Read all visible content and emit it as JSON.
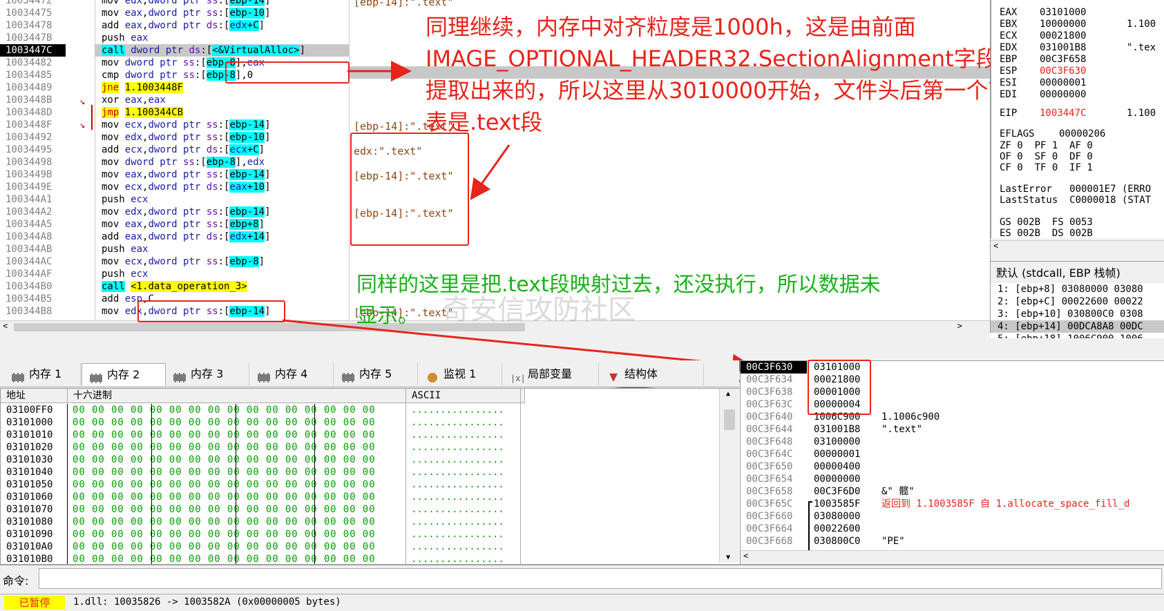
{
  "disasm": {
    "addresses": [
      "10034472",
      "10034475",
      "10034478",
      "1003447B",
      "1003447C",
      "10034482",
      "10034485",
      "10034489",
      "1003448B",
      "1003448D",
      "1003448F",
      "10034492",
      "10034495",
      "10034498",
      "1003449B",
      "1003449E",
      "100344A1",
      "100344A2",
      "100344A5",
      "100344A8",
      "100344AB",
      "100344AC",
      "100344AF",
      "100344B0",
      "100344B5",
      "100344B8"
    ],
    "top_partial_address": "10034471",
    "top_partial_instr": "push ecx",
    "instructions": [
      {
        "m": "mov",
        "ops": "edx,dword ptr ss:[ebp-14]"
      },
      {
        "m": "mov",
        "ops": "eax,dword ptr ss:[ebp-10]"
      },
      {
        "m": "add",
        "ops": "eax,dword ptr ds:[edx+C]"
      },
      {
        "m": "push",
        "ops": "eax"
      },
      {
        "m": "call",
        "ops": "dword ptr ds:[<&VirtualAlloc>]"
      },
      {
        "m": "mov",
        "ops": "dword ptr ss:[ebp-8],eax"
      },
      {
        "m": "cmp",
        "ops": "dword ptr ss:[ebp-8],0"
      },
      {
        "m": "jne",
        "ops": "1.1003448F"
      },
      {
        "m": "xor",
        "ops": "eax,eax"
      },
      {
        "m": "jmp",
        "ops": "1.100344CB"
      },
      {
        "m": "mov",
        "ops": "ecx,dword ptr ss:[ebp-14]"
      },
      {
        "m": "mov",
        "ops": "edx,dword ptr ss:[ebp-10]"
      },
      {
        "m": "add",
        "ops": "ecx,dword ptr ds:[ecx+C]"
      },
      {
        "m": "mov",
        "ops": "dword ptr ss:[ebp-8],edx"
      },
      {
        "m": "mov",
        "ops": "eax,dword ptr ss:[ebp-14]"
      },
      {
        "m": "mov",
        "ops": "ecx,dword ptr ds:[eax+10]"
      },
      {
        "m": "push",
        "ops": "ecx"
      },
      {
        "m": "mov",
        "ops": "edx,dword ptr ss:[ebp-14]"
      },
      {
        "m": "mov",
        "ops": "eax,dword ptr ss:[ebp+8]"
      },
      {
        "m": "add",
        "ops": "eax,dword ptr ds:[edx+14]"
      },
      {
        "m": "push",
        "ops": "eax"
      },
      {
        "m": "mov",
        "ops": "ecx,dword ptr ss:[ebp-8]"
      },
      {
        "m": "push",
        "ops": "ecx"
      },
      {
        "m": "call",
        "ops": "<1.data_operation_3>"
      },
      {
        "m": "add",
        "ops": "esp,C"
      },
      {
        "m": "mov",
        "ops": "edx,dword ptr ss:[ebp-14]"
      }
    ],
    "comments": [
      {
        "row": 0,
        "text": "[ebp-14]:\".text\""
      },
      {
        "row": 10,
        "text": "[ebp-14]:\".text\""
      },
      {
        "row": 12,
        "text": "edx:\".text\""
      },
      {
        "row": 14,
        "text": "[ebp-14]:\".text\""
      },
      {
        "row": 17,
        "text": "[ebp-14]:\".text\""
      },
      {
        "row": 25,
        "text": "[ebp-14]:\".text\""
      }
    ]
  },
  "annotations": {
    "red_note_lines": [
      "同理继续，内存中对齐粒度是1000h，这是由前面",
      "IMAGE_OPTIONAL_HEADER32.SectionAlignment字段",
      "提取出来的，所以这里从3010000开始，文件头后第一个节",
      "表是.text段"
    ],
    "green_note_lines": [
      "同样的这里是把.text段映射过去，还没执行，所以数据未",
      "显示。"
    ],
    "watermark": "奇安信攻防社区"
  },
  "registers": {
    "rows": [
      {
        "name": "EAX",
        "value": "03101000",
        "extra": ""
      },
      {
        "name": "EBX",
        "value": "10000000",
        "extra": "1.100"
      },
      {
        "name": "ECX",
        "value": "00021800",
        "extra": ""
      },
      {
        "name": "EDX",
        "value": "031001B8",
        "extra": "\".tex"
      },
      {
        "name": "EBP",
        "value": "00C3F658",
        "extra": ""
      },
      {
        "name": "ESP",
        "value": "00C3F630",
        "extra": ""
      },
      {
        "name": "ESI",
        "value": "00000001",
        "extra": ""
      },
      {
        "name": "EDI",
        "value": "00000000",
        "extra": ""
      }
    ],
    "eip": {
      "name": "EIP",
      "value": "1003447C",
      "extra": "1.100"
    },
    "eflags": {
      "name": "EFLAGS",
      "value": "00000206"
    },
    "flags": [
      "ZF 0  PF 1  AF 0",
      "OF 0  SF 0  DF 0",
      "CF 0  TF 0  IF 1"
    ],
    "last_error": "LastError   000001E7 (ERRO",
    "last_status": "LastStatus  C0000018 (STAT",
    "segs": [
      "GS 002B  FS 0053",
      "ES 002B  DS 002B"
    ]
  },
  "call_convention": "默认 (stdcall, EBP 栈帧)",
  "stack_args": [
    "1: [ebp+8] 03080000 03080",
    "2: [ebp+C] 00022600 00022",
    "3: [ebp+10] 030800C0 0308",
    "4: [ebp+14] 00DCA8A8 00DC",
    "5: [ebp+18] 1006C900 1006"
  ],
  "tabs": [
    {
      "label": "内存 1"
    },
    {
      "label": "内存 2"
    },
    {
      "label": "内存 3"
    },
    {
      "label": "内存 4"
    },
    {
      "label": "内存 5"
    },
    {
      "label": "监视 1"
    },
    {
      "label": "局部变量"
    },
    {
      "label": "结构体"
    }
  ],
  "dump": {
    "headers": [
      "地址",
      "十六进制",
      "ASCII"
    ],
    "rows": [
      "03100FF0",
      "03101000",
      "03101010",
      "03101020",
      "03101030",
      "03101040",
      "03101050",
      "03101060",
      "03101070",
      "03101080",
      "03101090",
      "031010A0",
      "031010B0"
    ],
    "hex_line": "00 00 00 00 00 00 00 00 00 00 00 00 00 00 00 00",
    "ascii_line": "................"
  },
  "stack": {
    "rows": [
      {
        "addr": "00C3F630",
        "val": "03101000",
        "cmt": ""
      },
      {
        "addr": "00C3F634",
        "val": "00021800",
        "cmt": ""
      },
      {
        "addr": "00C3F638",
        "val": "00001000",
        "cmt": ""
      },
      {
        "addr": "00C3F63C",
        "val": "00000004",
        "cmt": ""
      },
      {
        "addr": "00C3F640",
        "val": "1006C900",
        "cmt": "1.1006c900"
      },
      {
        "addr": "00C3F644",
        "val": "031001B8",
        "cmt": "\".text\""
      },
      {
        "addr": "00C3F648",
        "val": "03100000",
        "cmt": ""
      },
      {
        "addr": "00C3F64C",
        "val": "00000001",
        "cmt": ""
      },
      {
        "addr": "00C3F650",
        "val": "00000400",
        "cmt": ""
      },
      {
        "addr": "00C3F654",
        "val": "00000000",
        "cmt": ""
      },
      {
        "addr": "00C3F658",
        "val": "00C3F6D0",
        "cmt": "&\" 髋\""
      },
      {
        "addr": "00C3F65C",
        "val": "1003585F",
        "cmt": "返回到 1.1003585F 自 1.allocate_space_fill_d"
      },
      {
        "addr": "00C3F660",
        "val": "03080000",
        "cmt": ""
      },
      {
        "addr": "00C3F664",
        "val": "00022600",
        "cmt": ""
      },
      {
        "addr": "00C3F668",
        "val": "030800C0",
        "cmt": "\"PE\""
      }
    ]
  },
  "command": {
    "label": "命令:",
    "value": ""
  },
  "status": {
    "state": "已暂停",
    "message": "1.dll: 10035826 -> 1003582A (0x00000005 bytes)"
  },
  "colors": {
    "accent_red": "#e8231a",
    "green_note": "#19b219",
    "paused_bg": "#ffff00"
  }
}
